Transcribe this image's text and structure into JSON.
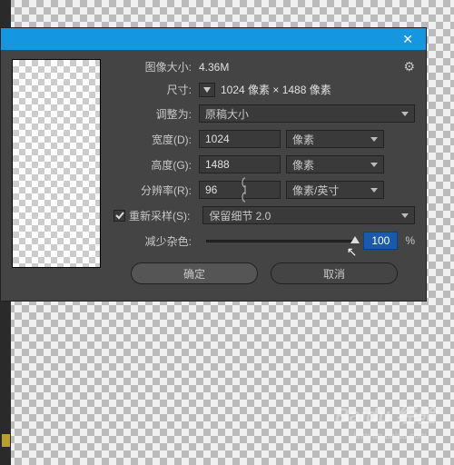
{
  "titlebar": {
    "close": "✕"
  },
  "header": {
    "sizeLabel": "图像大小:",
    "sizeValue": "4.36M",
    "gear": "⚙"
  },
  "dimensions": {
    "label": "尺寸:",
    "value": "1024 像素 × 1488 像素"
  },
  "fitTo": {
    "label": "调整为:",
    "value": "原稿大小"
  },
  "width": {
    "label": "宽度(D):",
    "value": "1024",
    "unit": "像素"
  },
  "height": {
    "label": "高度(G):",
    "value": "1488",
    "unit": "像素"
  },
  "resolution": {
    "label": "分辨率(R):",
    "value": "96",
    "unit": "像素/英寸"
  },
  "resample": {
    "label": "重新采样(S):",
    "method": "保留细节 2.0"
  },
  "noise": {
    "label": "减少杂色:",
    "value": "100",
    "pct": "%"
  },
  "buttons": {
    "ok": "确定",
    "cancel": "取消"
  },
  "watermark": {
    "main": "Baidu 经验",
    "sub": "jingyan.baidu.com"
  }
}
